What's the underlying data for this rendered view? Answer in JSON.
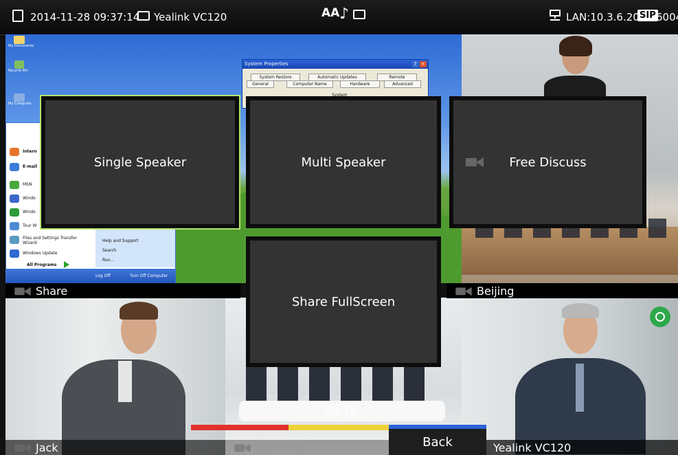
{
  "status_bar": {
    "datetime": "2014-11-28 09:37:14",
    "device": "Yealink VC120",
    "network": "LAN:10.3.6.201",
    "sip_badge": "SIP",
    "sip_account": "6004",
    "center_glyphs": "AA"
  },
  "layout_menu": {
    "options": [
      {
        "label": "Single Speaker"
      },
      {
        "label": "Multi Speaker"
      },
      {
        "label": "Free Discuss"
      },
      {
        "label": "Share FullScreen"
      }
    ]
  },
  "tiles": {
    "share_label": "Share",
    "beijing_label": "Beijing",
    "jack_label": "Jack",
    "australia_label": "Australia",
    "yealink_label": "Yealink VC120"
  },
  "desktop": {
    "icons": [
      "My Documents",
      "Recycle Bin",
      "My Computer"
    ],
    "start_menu_items": [
      "Intern",
      "E-mail",
      "MSN",
      "Windo",
      "Windo",
      "Tour W",
      "Files and Settings Transfer Wizard",
      "Windows Update",
      "All Programs"
    ],
    "start_menu_right": [
      "Help and Support",
      "Search",
      "Run..."
    ],
    "log_off": "Log Off",
    "turn_off": "Turn Off Computer",
    "dialog_title": "System Properties",
    "dialog_tabs_row1": [
      "System Restore",
      "Automatic Updates",
      "Remote"
    ],
    "dialog_tabs_row2": [
      "General",
      "Computer Name",
      "Hardware",
      "Advanced"
    ],
    "dialog_section": "System"
  },
  "call": {
    "timer": "08:15",
    "back_label": "Back"
  },
  "colors": {
    "selected_outline": "#b5e36b",
    "record_green": "#2da84b",
    "strip_red": "#e0322d",
    "strip_yellow": "#f0d23a",
    "strip_blue": "#2b63d7"
  }
}
